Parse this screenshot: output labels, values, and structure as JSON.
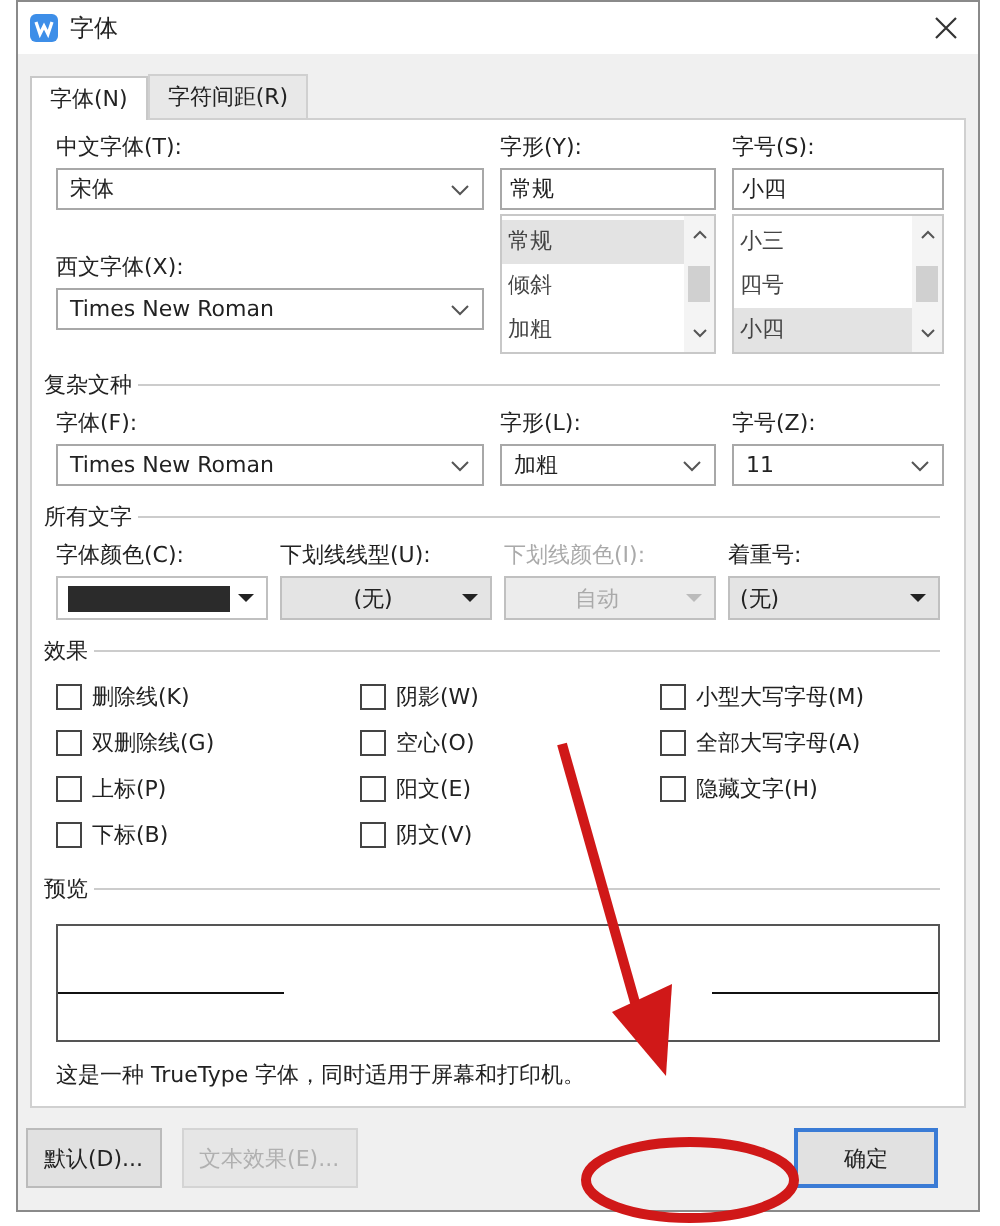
{
  "window": {
    "title": "字体"
  },
  "tabs": [
    {
      "label": "字体(N)",
      "selected": true
    },
    {
      "label": "字符间距(R)",
      "selected": false
    }
  ],
  "chinese_font": {
    "label": "中文字体(T):",
    "value": "宋体"
  },
  "font_style": {
    "label": "字形(Y):",
    "value": "常规",
    "options": [
      {
        "label": "常规",
        "selected": true
      },
      {
        "label": "倾斜",
        "selected": false
      },
      {
        "label": "加粗",
        "selected": false
      }
    ]
  },
  "font_size": {
    "label": "字号(S):",
    "value": "小四",
    "options": [
      {
        "label": "小三",
        "selected": false
      },
      {
        "label": "四号",
        "selected": false
      },
      {
        "label": "小四",
        "selected": true
      }
    ]
  },
  "western_font": {
    "label": "西文字体(X):",
    "value": "Times New Roman"
  },
  "complex_script": {
    "title": "复杂文种",
    "fields": [
      {
        "label": "字体(F):",
        "value": "Times New Roman"
      },
      {
        "label": "字形(L):",
        "value": "加粗"
      },
      {
        "label": "字号(Z):",
        "value": "11"
      }
    ]
  },
  "all_text": {
    "title": "所有文字",
    "fields": [
      {
        "kind": "color",
        "label": "字体颜色(C):",
        "color": "#2b2b2b",
        "disabled": false
      },
      {
        "kind": "list",
        "label": "下划线线型(U):",
        "value": "(无)",
        "disabled": false
      },
      {
        "kind": "list",
        "label": "下划线颜色(I):",
        "value": "自动",
        "disabled": true
      },
      {
        "kind": "combo",
        "label": "着重号:",
        "value": "(无)",
        "disabled": false
      }
    ]
  },
  "effects": {
    "title": "效果",
    "items": [
      {
        "label": "删除线(K)",
        "checked": false
      },
      {
        "label": "双删除线(G)",
        "checked": false
      },
      {
        "label": "上标(P)",
        "checked": false
      },
      {
        "label": "下标(B)",
        "checked": false
      },
      {
        "label": "阴影(W)",
        "checked": false
      },
      {
        "label": "空心(O)",
        "checked": false
      },
      {
        "label": "阳文(E)",
        "checked": false
      },
      {
        "label": "阴文(V)",
        "checked": false
      },
      {
        "label": "小型大写字母(M)",
        "checked": false
      },
      {
        "label": "全部大写字母(A)",
        "checked": false
      },
      {
        "label": "隐藏文字(H)",
        "checked": false
      }
    ]
  },
  "preview": {
    "title": "预览",
    "note": "这是一种 TrueType 字体，同时适用于屏幕和打印机。"
  },
  "buttons": [
    {
      "label": "默认(D)...",
      "disabled": false,
      "primary": false
    },
    {
      "label": "文本效果(E)...",
      "disabled": true,
      "primary": false
    },
    {
      "label": "确定",
      "disabled": false,
      "primary": true
    }
  ]
}
